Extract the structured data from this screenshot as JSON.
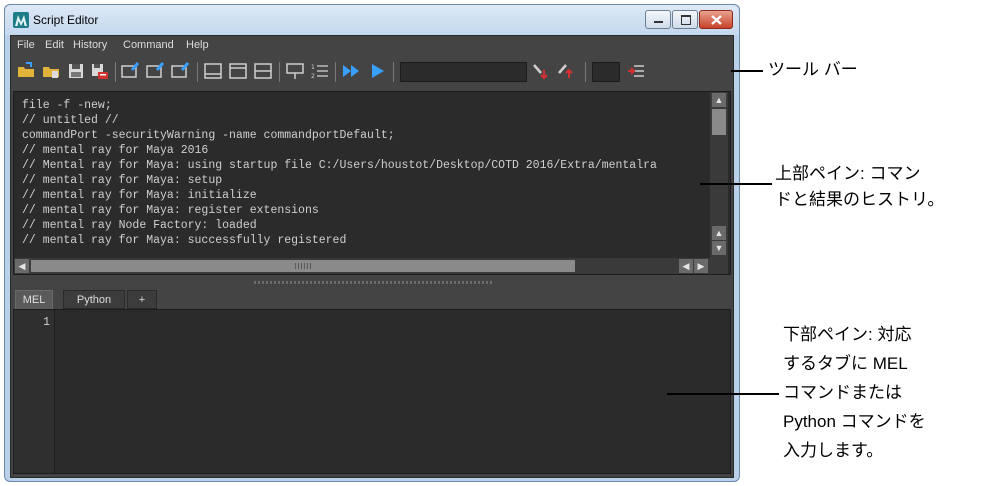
{
  "window": {
    "title": "Script Editor"
  },
  "menu": [
    "File",
    "Edit",
    "History",
    "Command",
    "Help"
  ],
  "output_log": [
    "file -f -new;",
    "// untitled //",
    "commandPort -securityWarning -name commandportDefault;",
    "// mental ray for Maya 2016",
    "// Mental ray for Maya: using startup file C:/Users/houstot/Desktop/COTD 2016/Extra/mentalra",
    "// mental ray for Maya: setup",
    "// mental ray for Maya: initialize",
    "// mental ray for Maya: register extensions",
    "// mental ray Node Factory: loaded",
    "// mental ray for Maya: successfully registered"
  ],
  "tabs": [
    "MEL",
    "Python",
    "+"
  ],
  "input": {
    "line_number": "1",
    "text": ""
  },
  "annotations": {
    "toolbar": "ツール バー",
    "upper_pane": [
      "上部ペイン: コマン",
      "ドと結果のヒストリ。"
    ],
    "lower_pane": [
      "下部ペイン: 対応",
      "するタブに MEL",
      "コマンドまたは",
      "Python コマンドを",
      "入力します。"
    ]
  },
  "colors": {
    "panel": "#444444",
    "editor": "#2b2b2b",
    "text": "#cfcfcf",
    "blue_icon": "#3aa0ff",
    "orange_icon": "#e0a020",
    "red_icon": "#d33030"
  }
}
